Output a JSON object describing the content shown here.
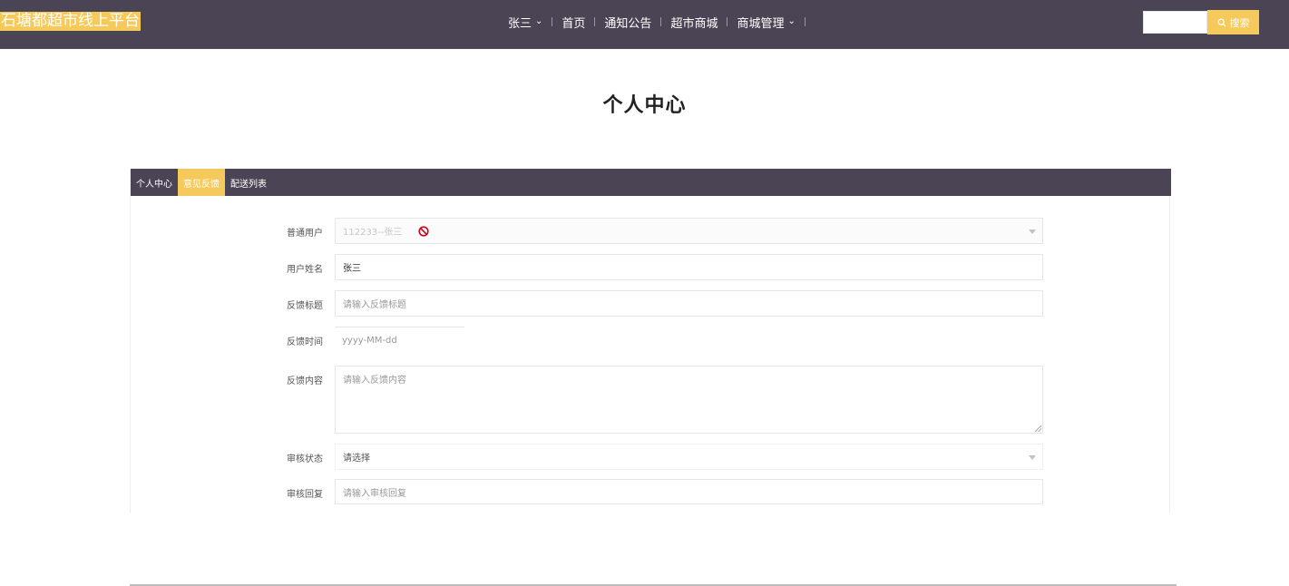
{
  "brand": "石塘都超市线上平台",
  "nav": {
    "user": "张三",
    "items": [
      "首页",
      "通知公告",
      "超市商城",
      "商城管理"
    ]
  },
  "search": {
    "placeholder": "",
    "button_label": "搜索"
  },
  "page_title": "个人中心",
  "tabs": [
    {
      "label": "个人中心",
      "active": false
    },
    {
      "label": "意见反馈",
      "active": true
    },
    {
      "label": "配送列表",
      "active": false
    }
  ],
  "form": {
    "user_account": {
      "label": "普通用户",
      "value": "112233--张三"
    },
    "user_name": {
      "label": "用户姓名",
      "value": "张三"
    },
    "feedback_title": {
      "label": "反馈标题",
      "placeholder": "请输入反馈标题"
    },
    "feedback_time": {
      "label": "反馈时间",
      "placeholder": "yyyy-MM-dd"
    },
    "feedback_content": {
      "label": "反馈内容",
      "placeholder": "请输入反馈内容"
    },
    "review_status": {
      "label": "审核状态",
      "value": "请选择"
    },
    "review_reply": {
      "label": "审核回复",
      "placeholder": "请输入审核回复"
    }
  },
  "colors": {
    "nav_bg": "#4b4454",
    "accent": "#f6c95b"
  }
}
